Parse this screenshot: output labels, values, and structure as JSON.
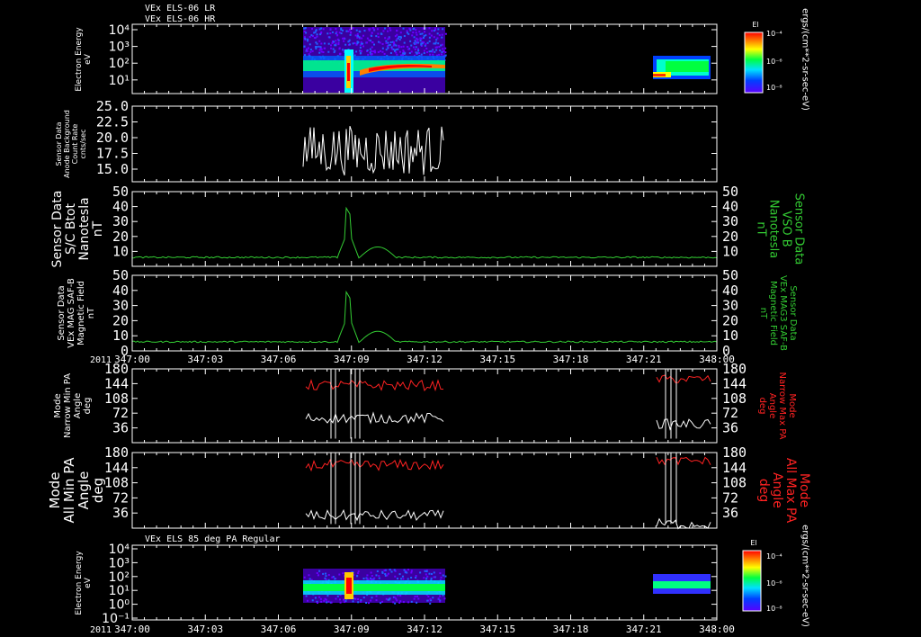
{
  "header": {
    "line1": "VEx ELS-06 LR",
    "line2": "VEx ELS-06 HR"
  },
  "time_axis": {
    "year": "2011",
    "ticks": [
      "347:00",
      "347:03",
      "347:06",
      "347:09",
      "347:12",
      "347:15",
      "347:18",
      "347:21",
      "348:00"
    ]
  },
  "chart_data": [
    {
      "type": "heatmap",
      "id": "els-spectrogram-top",
      "ylabel": [
        "Electron Energy",
        "eV"
      ],
      "yscale": "log",
      "yticks": [
        "10⁴",
        "10³",
        "10²",
        "10¹"
      ],
      "data_intervals": [
        [
          "347:06.5",
          "347:12.5"
        ],
        [
          "347:21.2",
          "347:23.8"
        ]
      ],
      "colorbar": {
        "title": "El",
        "ticks": [
          "10⁻⁴",
          "10⁻⁶",
          "10⁻⁸"
        ],
        "unit": "ergs/(cm**2-sr-sec-eV)"
      }
    },
    {
      "type": "line",
      "id": "anode-background",
      "ylabel": [
        "Sensor Data",
        "Anode Background",
        "Count Rate",
        "cnts/sec"
      ],
      "yticks": [
        "25.0",
        "22.5",
        "20.0",
        "17.5",
        "15.0"
      ],
      "ylim": [
        13.0,
        25.0
      ],
      "color": "#ffffff",
      "x_range": [
        "347:06.5",
        "347:12.5"
      ],
      "description": "noisy signal fluctuating between ~13 and ~22"
    },
    {
      "type": "line",
      "id": "sc-btot",
      "ylabel": [
        "Sensor Data",
        "S/C Btot",
        "Nanotesla",
        "nT"
      ],
      "ylabel_right": [
        "Sensor Data",
        "VSO B",
        "Nanotesla",
        "nT"
      ],
      "yticks": [
        "50",
        "40",
        "30",
        "20",
        "10"
      ],
      "ylim": [
        0,
        50
      ],
      "color": "#33cc33",
      "baseline": 6,
      "peak": 39,
      "peak_time": "347:08.5"
    },
    {
      "type": "line",
      "id": "mag-saf-b",
      "ylabel": [
        "Sensor Data",
        "VEx MAG SAF-B",
        "Magnetic Field",
        "nT"
      ],
      "ylabel_right": [
        "Sensor Data",
        "VEx MAG3 SAF-B",
        "Magnetic Field",
        "nT"
      ],
      "yticks": [
        "50",
        "40",
        "30",
        "20",
        "10",
        "0"
      ],
      "ylim": [
        0,
        50
      ],
      "color": "#33cc33",
      "baseline": 6,
      "peak": 39,
      "peak_time": "347:08.5"
    },
    {
      "type": "line",
      "id": "narrow-pa",
      "ylabel": [
        "Mode",
        "Narrow Min PA",
        "Angle",
        "deg"
      ],
      "ylabel_right": [
        "Mode",
        "Narrow Max PA",
        "Angle",
        "deg"
      ],
      "yticks": [
        "180",
        "144",
        "108",
        "72",
        "36"
      ],
      "ylim": [
        0,
        180
      ],
      "series": [
        {
          "name": "Narrow Min PA",
          "color": "#ffffff"
        },
        {
          "name": "Narrow Max PA",
          "color": "#ff2222"
        }
      ]
    },
    {
      "type": "line",
      "id": "all-pa",
      "ylabel": [
        "Mode",
        "All Min PA",
        "Angle",
        "deg"
      ],
      "ylabel_right": [
        "Mode",
        "All Max PA",
        "Angle",
        "deg"
      ],
      "yticks": [
        "180",
        "144",
        "108",
        "72",
        "36"
      ],
      "ylim": [
        0,
        180
      ],
      "series": [
        {
          "name": "All Min PA",
          "color": "#ffffff"
        },
        {
          "name": "All Max PA",
          "color": "#ff2222"
        }
      ]
    },
    {
      "type": "heatmap",
      "id": "els-spectrogram-bottom",
      "title": "VEx ELS 85 deg PA Regular",
      "ylabel": [
        "Electron Energy",
        "eV"
      ],
      "yscale": "log",
      "yticks": [
        "10⁴",
        "10³",
        "10²",
        "10¹",
        "10⁰",
        "10⁻¹"
      ],
      "colorbar": {
        "title": "El",
        "ticks": [
          "10⁻⁴",
          "10⁻⁶",
          "10⁻⁸"
        ],
        "unit": "ergs/(cm**2-sr-sec-eV)"
      }
    }
  ]
}
